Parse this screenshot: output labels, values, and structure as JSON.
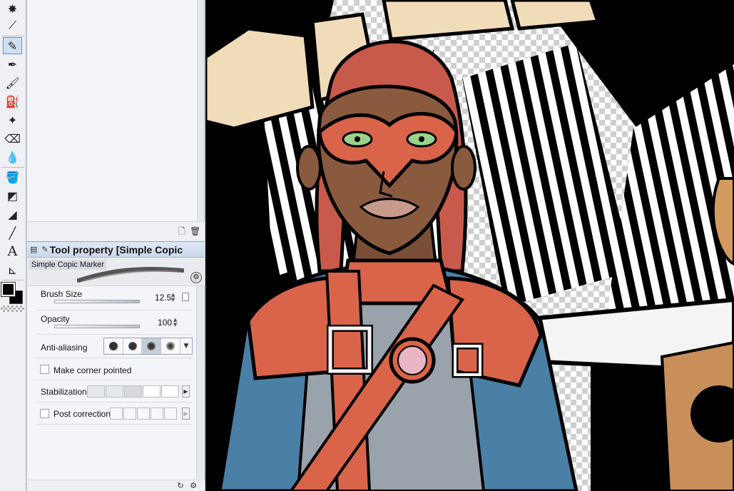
{
  "toolbar": {
    "tools": [
      {
        "name": "sparkle-tool-icon",
        "glyph": "✸"
      },
      {
        "name": "eyedropper-icon",
        "glyph": "⟋"
      },
      {
        "name": "marker-tool-icon",
        "glyph": "✎"
      },
      {
        "name": "pen-tool-icon",
        "glyph": "✒"
      },
      {
        "name": "brush-tool-icon",
        "glyph": "🖌"
      },
      {
        "name": "airbrush-tool-icon",
        "glyph": "⛽"
      },
      {
        "name": "decoration-tool-icon",
        "glyph": "✦"
      },
      {
        "name": "eraser-tool-icon",
        "glyph": "⌫"
      },
      {
        "name": "blend-tool-icon",
        "glyph": "💧"
      },
      {
        "name": "fill-tool-icon",
        "glyph": "🪣"
      },
      {
        "name": "gradient-tool-icon",
        "glyph": "◩"
      },
      {
        "name": "figure-tool-icon",
        "glyph": "◢"
      },
      {
        "name": "line-tool-icon",
        "glyph": "╱"
      },
      {
        "name": "text-tool-icon",
        "glyph": "A"
      },
      {
        "name": "ruler-tool-icon",
        "glyph": "⊾"
      }
    ],
    "colors": {
      "main": "#000000",
      "sub": "#000000"
    }
  },
  "tool_property": {
    "title": "Tool property [Simple Copic",
    "brush_name": "Simple Copic Marker",
    "brush_size": {
      "label": "Brush Size",
      "value": "12.5",
      "fill": 0.25
    },
    "opacity": {
      "label": "Opacity",
      "value": "100",
      "fill": 1.0
    },
    "anti_aliasing": {
      "label": "Anti-aliasing",
      "selected": 2
    },
    "make_corner_pointed": {
      "label": "Make corner pointed",
      "checked": false
    },
    "stabilization": {
      "label": "Stabilization"
    },
    "post_correction": {
      "label": "Post correction",
      "checked": false
    }
  },
  "colors": {
    "panel_bg": "#f3f5f9",
    "header_bg": "#cbd8ec",
    "active_tool": "#cfe0f5",
    "skin": "#8a5a3f",
    "mask_red": "#d9644a",
    "hair_red": "#c85a4c",
    "suit_blue": "#4a7fa6",
    "suit_gray": "#9aa2ab",
    "eye_green": "#9bd28a",
    "title_cream": "#f1dcb9"
  }
}
